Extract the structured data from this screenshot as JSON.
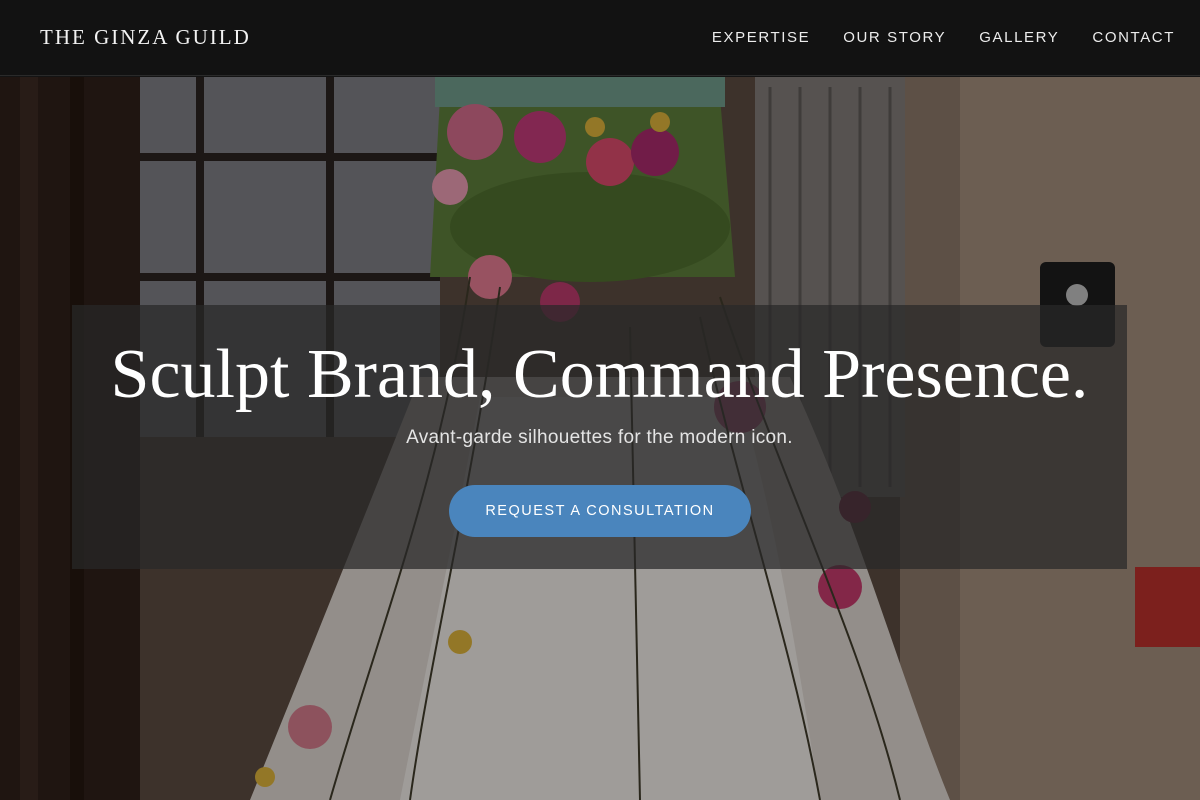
{
  "header": {
    "brand": "THE GINZA GUILD",
    "nav": [
      "EXPERTISE",
      "OUR STORY",
      "GALLERY",
      "CONTACT"
    ]
  },
  "hero": {
    "headline": "Sculpt Brand, Command Presence.",
    "subheadline": "Avant-garde silhouettes for the modern icon.",
    "cta_label": "REQUEST A CONSULTATION",
    "background": "floral-dress-sculpture-photo"
  },
  "colors": {
    "header_bg": "#121212",
    "cta_bg": "#4a85bd",
    "card_bg": "rgba(40,40,40,0.72)",
    "text": "#ffffff"
  }
}
